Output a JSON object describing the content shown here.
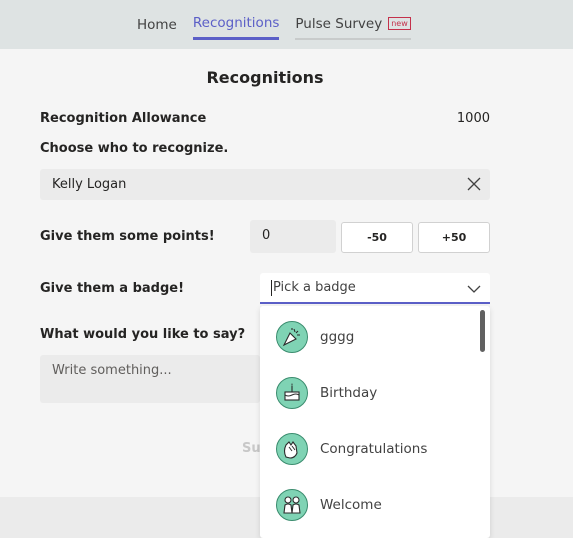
{
  "nav": {
    "tabs": [
      {
        "label": "Home"
      },
      {
        "label": "Recognitions"
      },
      {
        "label": "Pulse Survey",
        "badge": "new"
      }
    ],
    "active_tab": "Recognitions"
  },
  "page": {
    "title": "Recognitions",
    "allowance_label": "Recognition Allowance",
    "allowance_value": "1000",
    "choose_label": "Choose who to recognize.",
    "recipient_value": "Kelly Logan",
    "points_label": "Give them some points!",
    "points_value": "0",
    "minus_button": "-50",
    "plus_button": "+50",
    "badge_label": "Give them a badge!",
    "badge_placeholder": "Pick a badge",
    "message_label": "What would you like to say?",
    "message_placeholder": "Write something...",
    "submit_partial": "Sub"
  },
  "dropdown": {
    "options": [
      {
        "label": "gggg",
        "icon": "party-popper-icon"
      },
      {
        "label": "Birthday",
        "icon": "birthday-cake-icon"
      },
      {
        "label": "Congratulations",
        "icon": "clapping-hands-icon"
      },
      {
        "label": "Welcome",
        "icon": "welcome-people-icon"
      }
    ]
  },
  "colors": {
    "accent": "#5b5fc7",
    "new_badge": "#c4314b",
    "badge_icon_fill": "#7fd3b4"
  }
}
